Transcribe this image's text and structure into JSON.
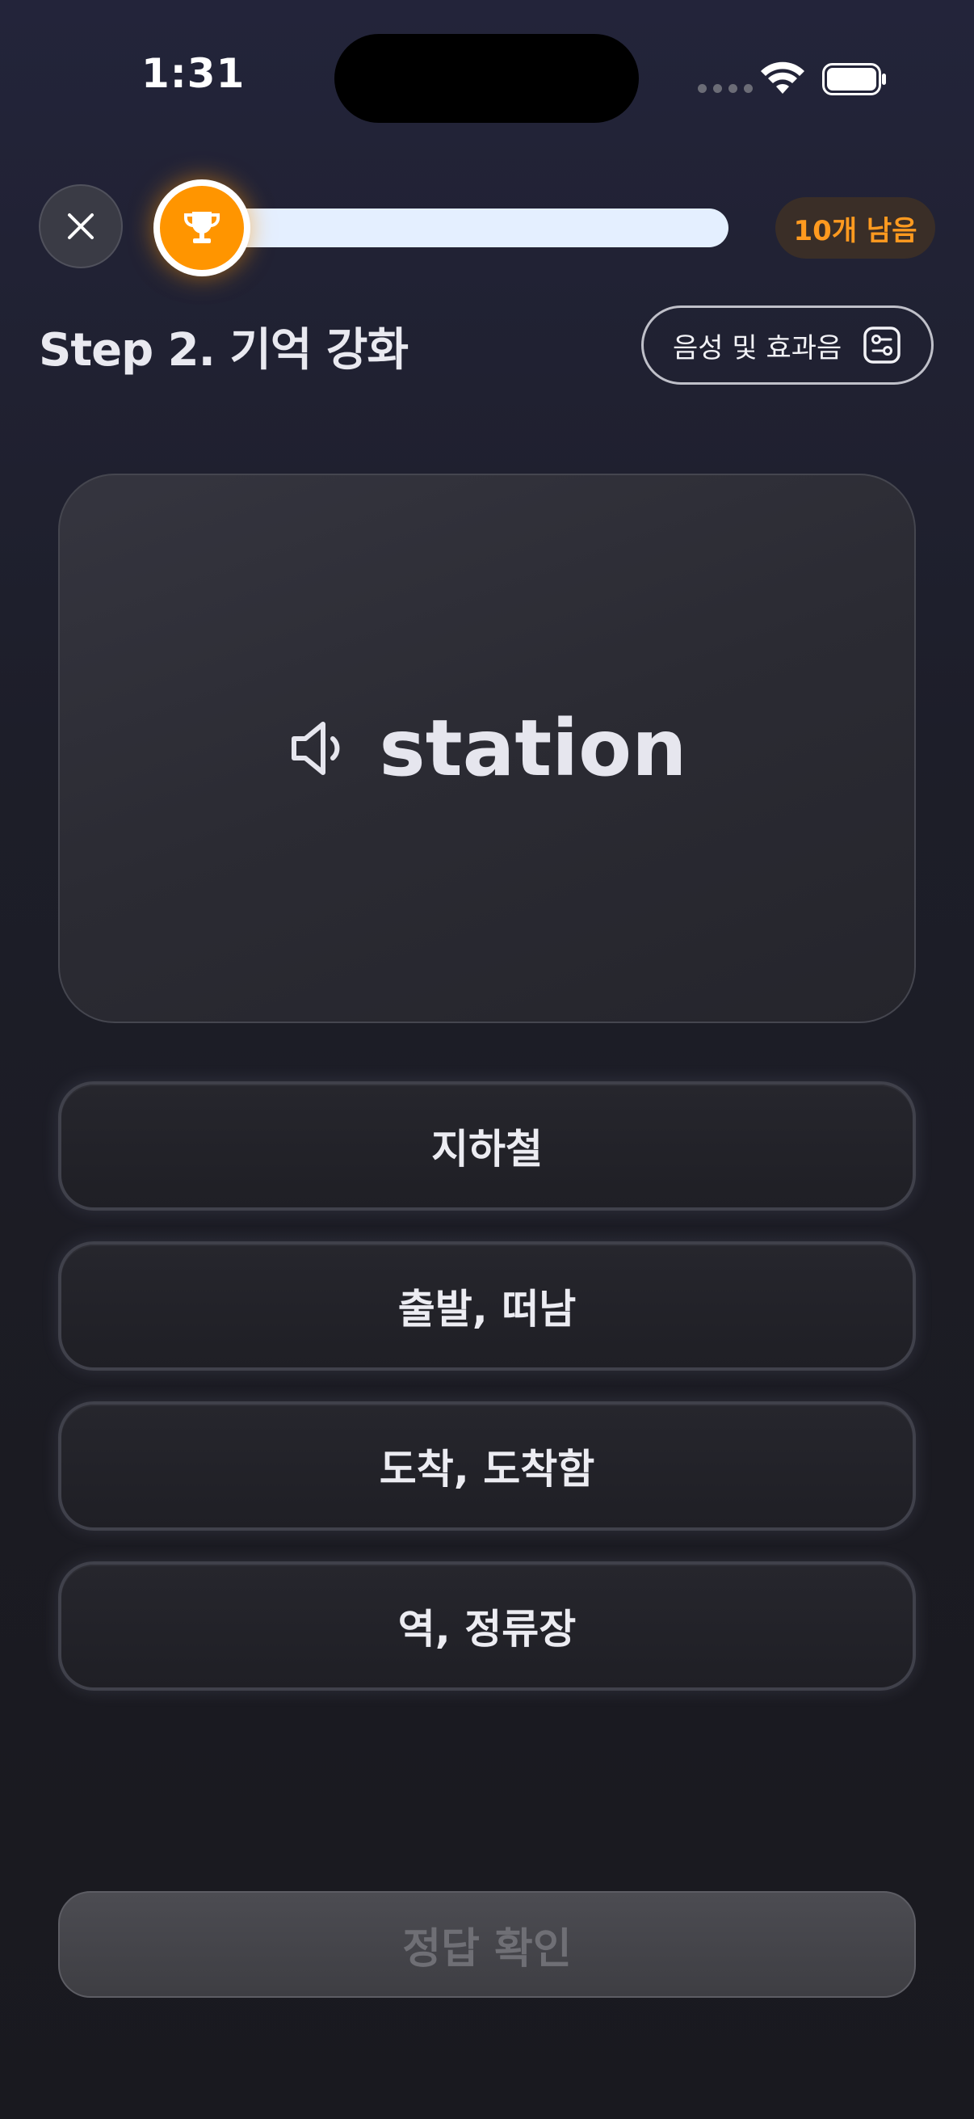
{
  "status_bar": {
    "time": "1:31"
  },
  "header": {
    "remaining_label": "10개 남음",
    "progress_fraction": 0.0
  },
  "title_row": {
    "step_title": "Step 2. 기억 강화",
    "sound_button_label": "음성 및 효과음"
  },
  "card": {
    "word": "station"
  },
  "options": [
    {
      "label": "지하철"
    },
    {
      "label": "출발, 떠남"
    },
    {
      "label": "도착, 도착함"
    },
    {
      "label": "역, 정류장"
    }
  ],
  "footer": {
    "confirm_label": "정답 확인"
  },
  "colors": {
    "accent_orange": "#ff9500",
    "progress_track": "#e4efff",
    "background_top": "#23243a",
    "background_bottom": "#19191f"
  },
  "icons": {
    "close": "close-icon",
    "trophy": "trophy-icon",
    "settings": "sliders-icon",
    "speaker": "speaker-icon",
    "wifi": "wifi-icon",
    "battery": "battery-icon"
  }
}
